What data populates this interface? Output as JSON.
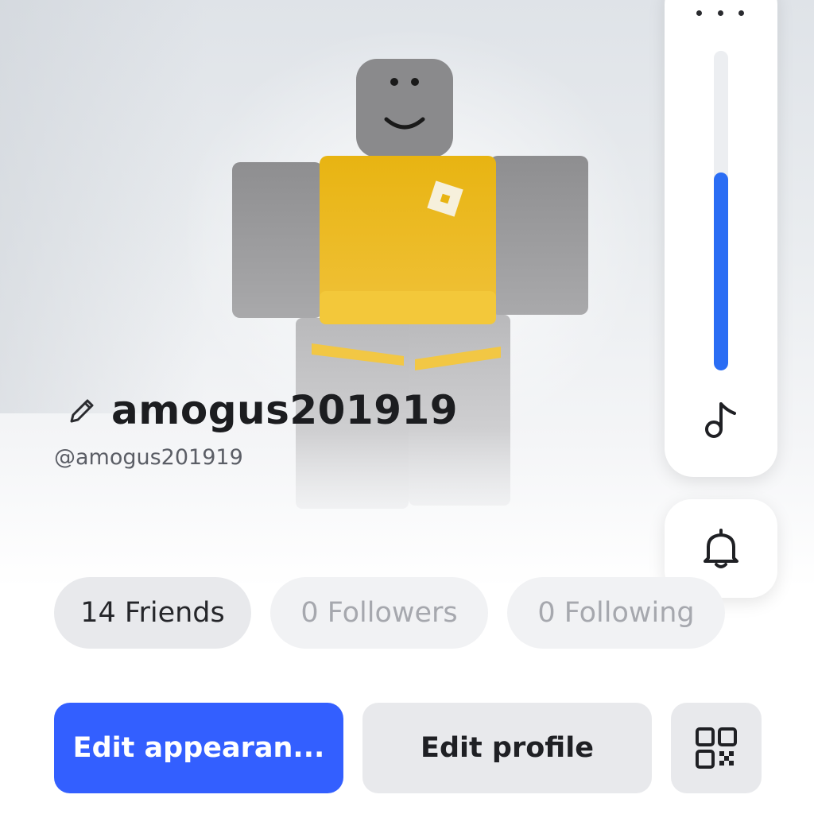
{
  "profile": {
    "display_name": "amogus201919",
    "username": "@amogus201919",
    "edit_name_icon": "pencil-icon"
  },
  "stats": {
    "friends_label": "14 Friends",
    "followers_label": "0 Followers",
    "following_label": "0 Following"
  },
  "actions": {
    "edit_appearance_label": "Edit appearan...",
    "edit_profile_label": "Edit profile",
    "qr_icon": "qr-code-icon"
  },
  "side_panel": {
    "more_icon": "more-horizontal-icon",
    "music_icon": "music-note-icon",
    "notification_icon": "bell-icon",
    "volume_level": 0.62
  },
  "colors": {
    "primary": "#335fff",
    "slider": "#2a6df4",
    "shirt": "#e6b418"
  }
}
